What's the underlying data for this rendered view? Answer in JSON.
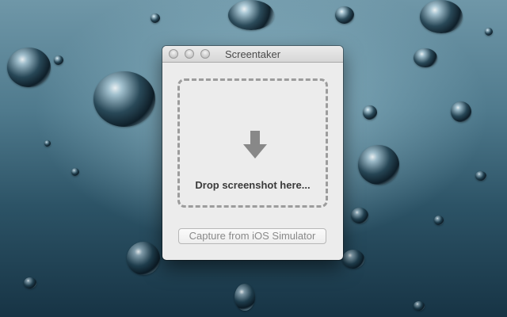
{
  "window": {
    "title": "Screentaker"
  },
  "dropzone": {
    "label": "Drop screenshot here...",
    "icon": "arrow-down-icon"
  },
  "actions": {
    "capture_label": "Capture from iOS Simulator",
    "capture_enabled": false
  },
  "desktop": {
    "wallpaper": "water droplets"
  },
  "colors": {
    "window_bg": "#ececec",
    "dropzone_border": "#9c9c9c",
    "arrow": "#888888",
    "label_text": "#3a3a3a",
    "disabled_text": "#8a8a8a"
  }
}
